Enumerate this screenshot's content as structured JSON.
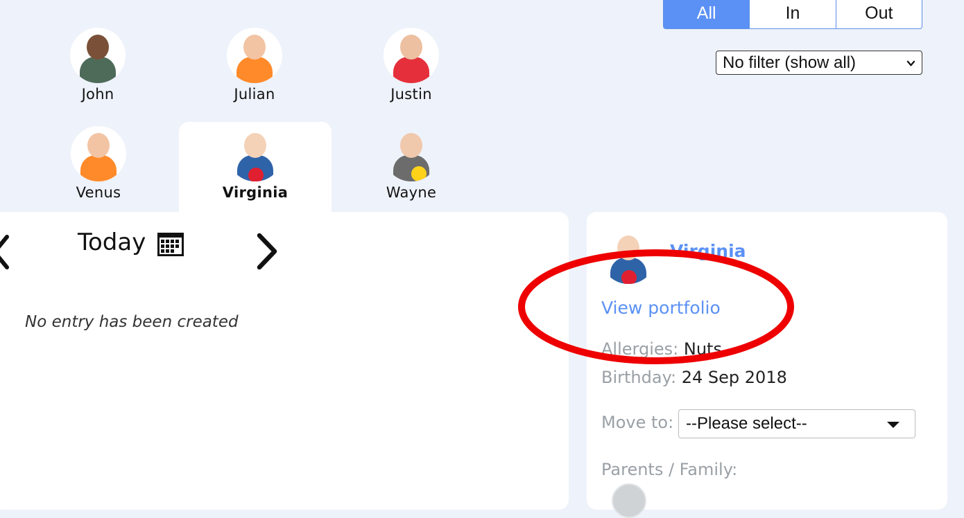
{
  "toggle": {
    "options": [
      "All",
      "In",
      "Out"
    ],
    "active": "All"
  },
  "filter": {
    "selected": "No filter (show all)"
  },
  "children": [
    {
      "name": "John"
    },
    {
      "name": "Julian"
    },
    {
      "name": "Justin"
    },
    {
      "name": "Venus"
    },
    {
      "name": "Virginia"
    },
    {
      "name": "Wayne"
    }
  ],
  "selected_child": "Virginia",
  "diary": {
    "date_label": "Today",
    "empty_message": "No entry has been created"
  },
  "profile": {
    "name": "Virginia",
    "view_portfolio": "View portfolio",
    "allergies_label": "Allergies:",
    "allergies_value": "Nuts",
    "birthday_label": "Birthday:",
    "birthday_value": "24 Sep 2018",
    "move_to_label": "Move to:",
    "move_to_value": "--Please select--",
    "parents_label": "Parents / Family:"
  },
  "colors": {
    "accent": "#5b91f5",
    "background": "#eef2fa",
    "annotation": "#ee0000"
  }
}
